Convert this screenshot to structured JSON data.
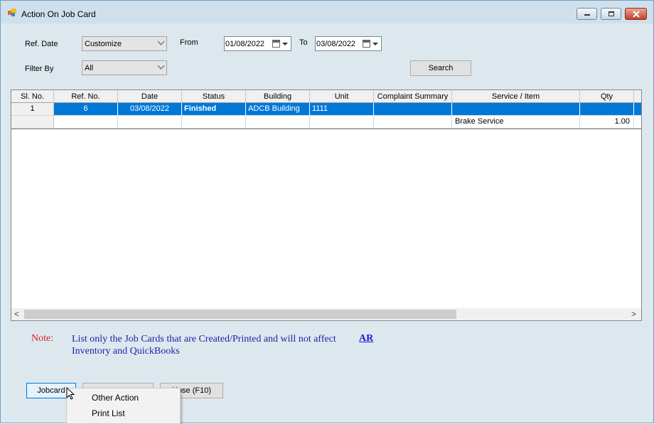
{
  "window": {
    "title": "Action On Job Card",
    "controls": [
      "minimize",
      "restore",
      "close"
    ]
  },
  "filters": {
    "ref_date_label": "Ref. Date",
    "ref_date_value": "Customize",
    "from_label": "From",
    "from_value": "01/08/2022",
    "to_label": "To",
    "to_value": "03/08/2022",
    "filter_by_label": "Filter By",
    "filter_by_value": "All",
    "search_label": "Search"
  },
  "grid": {
    "columns": [
      "Sl. No.",
      "Ref. No.",
      "Date",
      "Status",
      "Building",
      "Unit",
      "Complaint Summary",
      "Service / Item",
      "Qty"
    ],
    "rows": [
      {
        "sl": "1",
        "ref": "6",
        "date": "03/08/2022",
        "status": "Finished",
        "building": "ADCB Building",
        "unit": "1111",
        "complaint": "",
        "service": "",
        "qty": ""
      },
      {
        "sl": "",
        "ref": "",
        "date": "",
        "status": "",
        "building": "",
        "unit": "",
        "complaint": "",
        "service": "Brake Service",
        "qty": "1.00"
      }
    ],
    "scroll_left": "<",
    "scroll_right": ">"
  },
  "note": {
    "label": "Note:",
    "line1": "List only the Job Cards that are Created/Printed and will not affect",
    "line2": "Inventory and QuickBooks",
    "link": "AR"
  },
  "buttons": {
    "jobcard": "Jobcard",
    "close": "Close (F10)"
  },
  "context_menu": {
    "items": [
      "Other Action",
      "Print List"
    ]
  },
  "colors": {
    "selection": "#0078d7",
    "note_label": "#e01b1b",
    "note_text": "#2222a8"
  }
}
